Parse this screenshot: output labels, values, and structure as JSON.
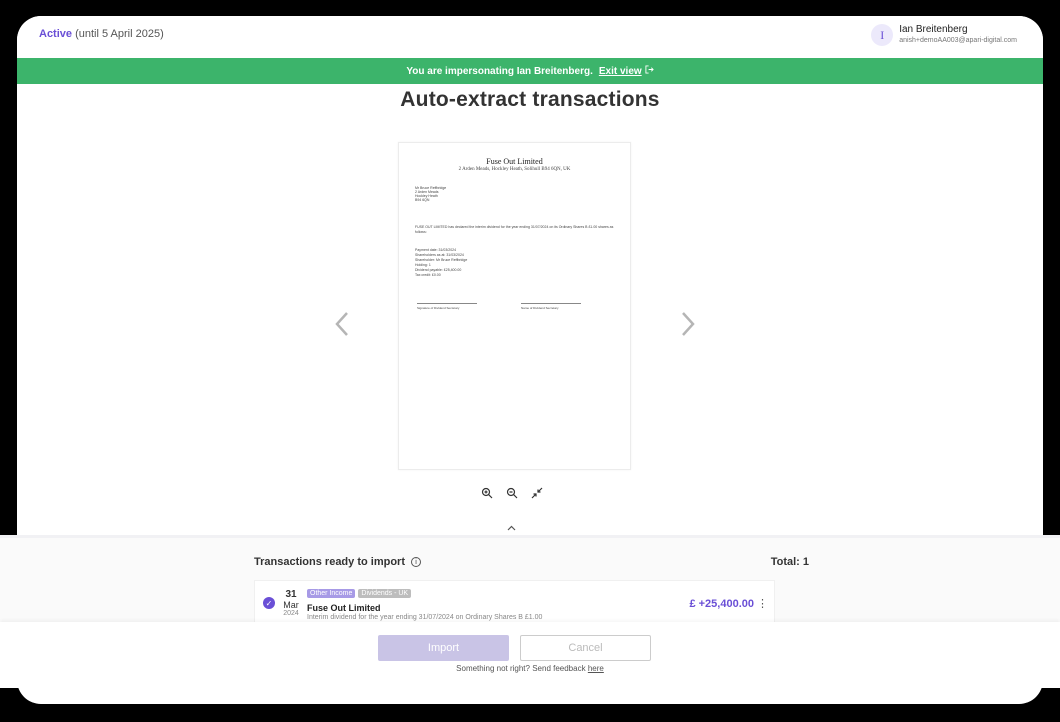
{
  "header": {
    "status_label": "Active",
    "status_detail": "(until 5 April 2025)",
    "user_initial": "I",
    "user_name": "Ian Breitenberg",
    "user_email": "anish+demoAA003@apari-digital.com"
  },
  "banner": {
    "text": "You are impersonating Ian Breitenberg.",
    "exit_label": "Exit view"
  },
  "page_title": "Auto-extract transactions",
  "document": {
    "company": "Fuse Out Limited",
    "address": "2 Arden Meads, Hockley Heath, Solihull B94 6QN, UK",
    "recipient_lines": [
      "Mr Bruce Reffbridge",
      "2 Arden Meads",
      "Hockley Heath",
      "B94 6QN"
    ],
    "declaration": "FUSE OUT LIMITED has declared the interim dividend for the year ending 31/07/2024 on its Ordinary Shares B £1.00 shares as follows:",
    "details": [
      "Payment date: 31/03/2024",
      "Shareholders as at: 31/03/2024",
      "Shareholder: Mr Bruce Reffbridge",
      "Holding: 1",
      "Dividend payable: £25,400.00",
      "Tax credit: £0.00"
    ],
    "sig_left": "Signature of Dividend Secretary",
    "sig_right": "Name of Dividend Secretary"
  },
  "transactions": {
    "heading": "Transactions ready to import",
    "total_label": "Total: 1",
    "items": [
      {
        "day": "31",
        "month": "Mar",
        "year": "2024",
        "tag1": "Other Income",
        "tag2": "Dividends - UK",
        "name": "Fuse Out Limited",
        "description": "Interim dividend for the year ending 31/07/2024 on Ordinary Shares B £1.00",
        "amount": "£ +25,400.00"
      }
    ]
  },
  "footer": {
    "import_label": "Import",
    "cancel_label": "Cancel",
    "feedback_text": "Something not right? Send feedback",
    "feedback_link": "here"
  },
  "colors": {
    "accent": "#6a4fd6",
    "banner": "#3cb46b"
  }
}
